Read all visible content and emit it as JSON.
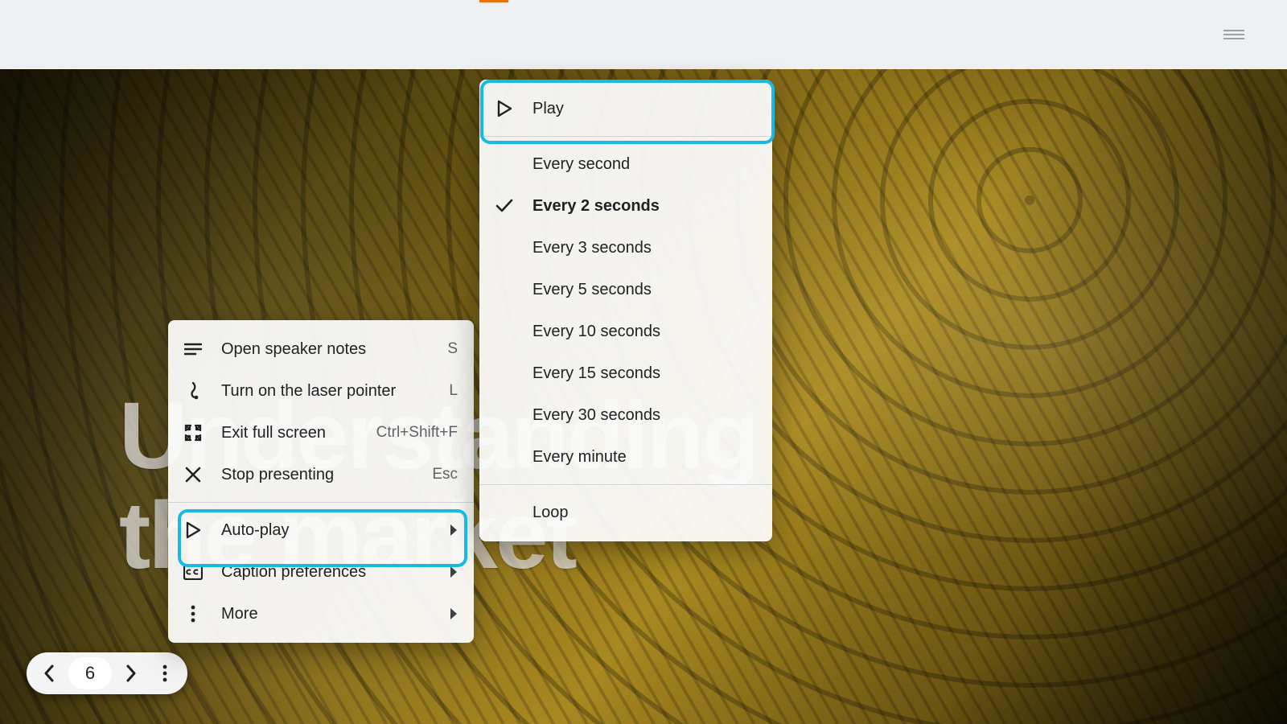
{
  "slide": {
    "title_line1": "Understanding",
    "title_line2": "the market"
  },
  "pill": {
    "slide_number": "6"
  },
  "menu_main": {
    "speaker_notes": {
      "label": "Open speaker notes",
      "accel": "S"
    },
    "laser_pointer": {
      "label": "Turn on the laser pointer",
      "accel": "L"
    },
    "exit_full": {
      "label": "Exit full screen",
      "accel": "Ctrl+Shift+F"
    },
    "stop_present": {
      "label": "Stop presenting",
      "accel": "Esc"
    },
    "auto_play": {
      "label": "Auto-play"
    },
    "captions": {
      "label": "Caption preferences"
    },
    "more": {
      "label": "More"
    }
  },
  "menu_autoplay": {
    "play": {
      "label": "Play"
    },
    "opt_1": {
      "label": "Every second"
    },
    "opt_2": {
      "label": "Every 2 seconds",
      "selected": true
    },
    "opt_3": {
      "label": "Every 3 seconds"
    },
    "opt_5": {
      "label": "Every 5 seconds"
    },
    "opt_10": {
      "label": "Every 10 seconds"
    },
    "opt_15": {
      "label": "Every 15 seconds"
    },
    "opt_30": {
      "label": "Every 30 seconds"
    },
    "opt_min": {
      "label": "Every minute"
    },
    "loop": {
      "label": "Loop"
    }
  }
}
